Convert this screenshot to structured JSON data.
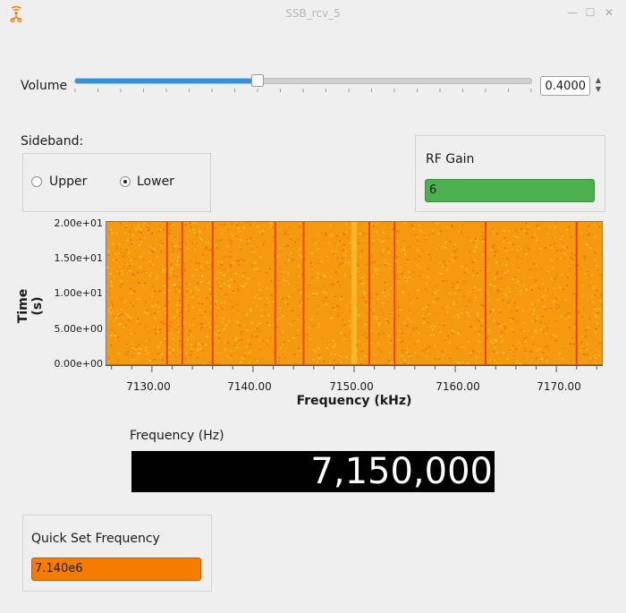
{
  "window": {
    "title": "SSB_rcv_5",
    "app_icon": "gnuradio-icon",
    "controls": [
      "minimize-icon",
      "maximize-icon",
      "close-icon"
    ]
  },
  "volume": {
    "label": "Volume",
    "value": "0.4000",
    "slider_fraction": 0.4
  },
  "sideband": {
    "label": "Sideband:",
    "options": [
      {
        "label": "Upper",
        "selected": false
      },
      {
        "label": "Lower",
        "selected": true
      }
    ]
  },
  "rf_gain": {
    "label": "RF Gain",
    "value": "6",
    "color": "#4caf50"
  },
  "chart_data": {
    "type": "heatmap",
    "ylabel": "Time (s)",
    "xlabel": "Frequency (kHz)",
    "y_ticks": [
      "2.00e+01",
      "1.50e+01",
      "1.00e+01",
      "5.00e+00",
      "0.00e+00"
    ],
    "y_tick_values": [
      20,
      15,
      10,
      5,
      0
    ],
    "x_ticks": [
      "7130.00",
      "7140.00",
      "7150.00",
      "7160.00",
      "7170.00"
    ],
    "x_tick_values": [
      7130,
      7140,
      7150,
      7160,
      7170
    ],
    "xlim": [
      7125.5,
      7174.5
    ],
    "ylim": [
      0,
      20
    ],
    "colors": {
      "background": "#f59a10",
      "line": "#e0390e",
      "speckle": "#f3c12a"
    },
    "signal_lines_khz": [
      7131.5,
      7133,
      7136,
      7142.2,
      7145,
      7151.5,
      7154,
      7163,
      7172
    ],
    "center_line_khz": 7150
  },
  "frequency": {
    "label": "Frequency (Hz)",
    "value": "7,150,000"
  },
  "quick_set": {
    "label": "Quick Set Frequency",
    "value": "7.140e6",
    "color": "#f57c00"
  }
}
